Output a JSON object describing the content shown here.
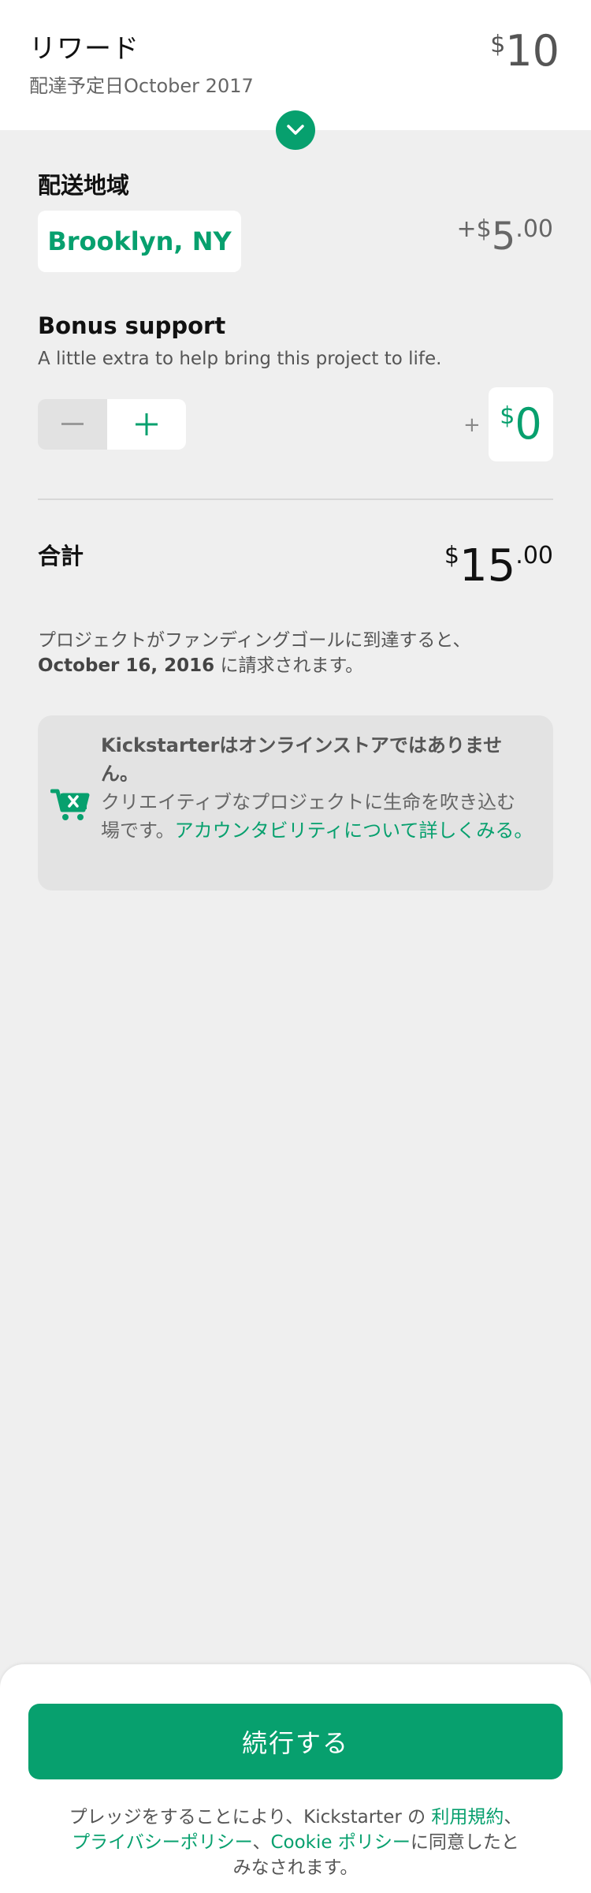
{
  "reward": {
    "title": "リワード",
    "delivery": "配達予定日October 2017",
    "currency": "$",
    "price": "10"
  },
  "shipping": {
    "label": "配送地域",
    "location": "Brooklyn, NY",
    "prefix": "+$",
    "amount": "5",
    "cents": ".00"
  },
  "bonus": {
    "label": "Bonus support",
    "description": "A little extra to help bring this project to life.",
    "plus_sign": "+",
    "currency": "$",
    "amount": "0"
  },
  "total": {
    "label": "合計",
    "currency": "$",
    "amount": "15",
    "cents": ".00"
  },
  "charge_note": {
    "line1": "プロジェクトがファンディングゴールに到達すると、",
    "date": "October 16, 2016",
    "line2": " に請求されます。"
  },
  "info": {
    "title": "Kickstarterはオンラインストアではありません。",
    "body": "クリエイティブなプロジェクトに生命を吹き込む場です。",
    "link": "アカウンタビリティについて詳しくみる。"
  },
  "footer": {
    "button": "続行する",
    "legal_prefix": "プレッジをすることにより、Kickstarter の ",
    "terms_link": "利用規約",
    "sep1": "、",
    "privacy_link": "プライバシーポリシー",
    "sep2": "、",
    "cookie_link": "Cookie ポリシー",
    "legal_suffix": "に同意したとみなされます。"
  },
  "colors": {
    "accent": "#07a06e",
    "background": "#efefef"
  }
}
